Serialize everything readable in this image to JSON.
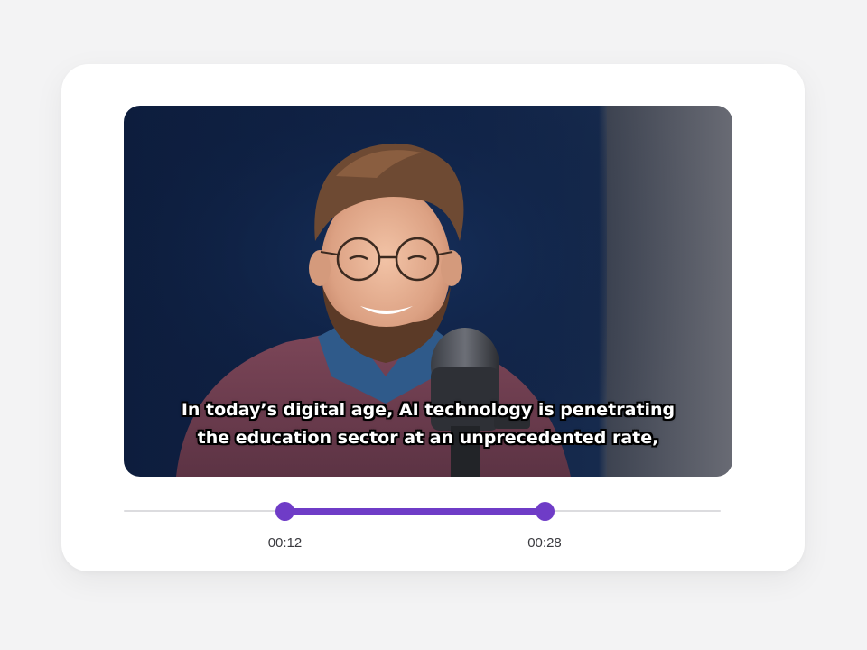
{
  "video": {
    "caption_lines": [
      "In today’s digital age, AI technology is penetrating",
      "the education sector at an unprecedented rate,"
    ]
  },
  "timeline": {
    "start_label": "00:12",
    "end_label": "00:28",
    "start_fraction": 0.27,
    "end_fraction": 0.705,
    "accent_color": "#6f3cc7",
    "track_color": "#dcdcdf"
  },
  "icons": {
    "microphone": "microphone-icon"
  }
}
